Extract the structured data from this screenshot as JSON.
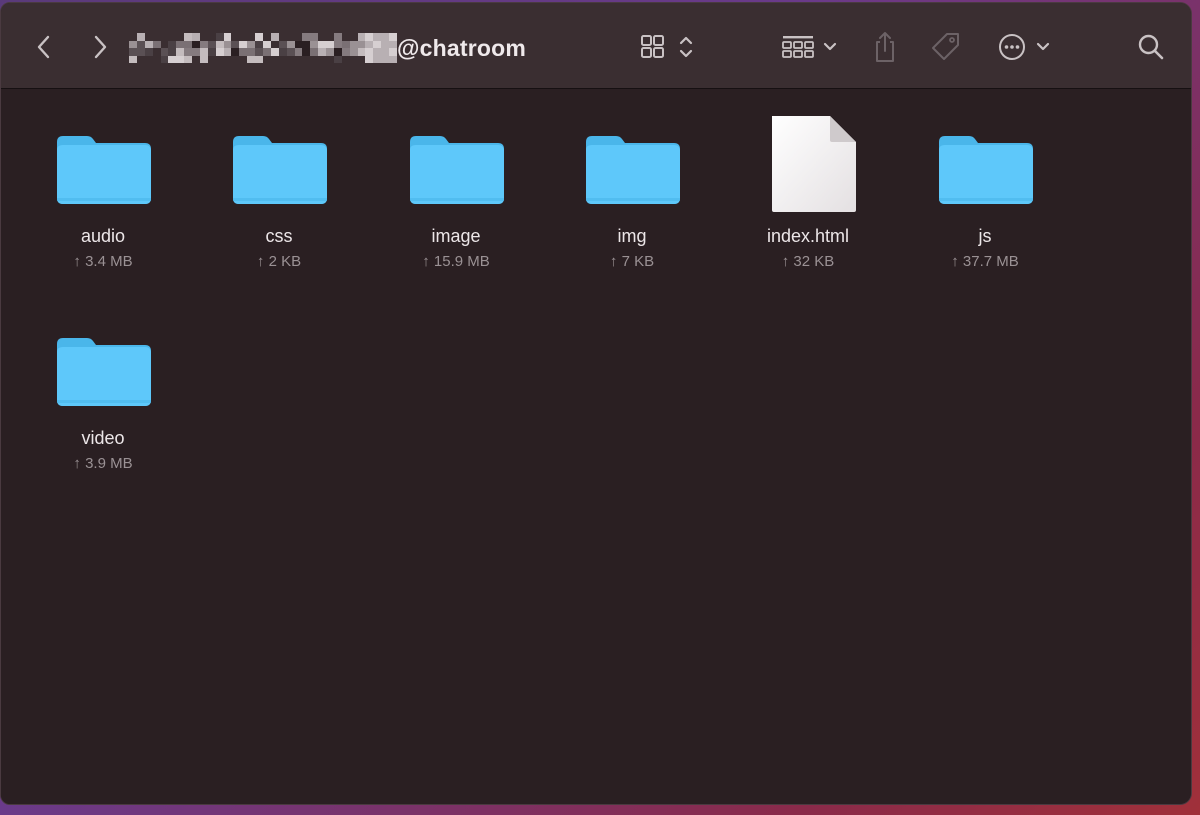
{
  "window": {
    "title": "@chatroom",
    "title_prefix_redacted": true
  },
  "toolbar": {
    "back_icon": "chevron-left-icon",
    "forward_icon": "chevron-right-icon",
    "view_icon": "grid-view-icon",
    "group_icon": "group-by-icon",
    "share_icon": "share-icon",
    "tag_icon": "tag-icon",
    "more_icon": "ellipsis-circle-icon",
    "search_icon": "search-icon"
  },
  "colors": {
    "folder": "#5ec8fa",
    "folder_tab": "#4ab6ea",
    "window_bg": "#2a1f22",
    "toolbar_bg": "#3a2e31"
  },
  "files": [
    {
      "name": "audio",
      "size": "↑ 3.4 MB",
      "kind": "folder"
    },
    {
      "name": "css",
      "size": "↑ 2 KB",
      "kind": "folder"
    },
    {
      "name": "image",
      "size": "↑ 15.9 MB",
      "kind": "folder"
    },
    {
      "name": "img",
      "size": "↑ 7 KB",
      "kind": "folder"
    },
    {
      "name": "index.html",
      "size": "↑ 32 KB",
      "kind": "document"
    },
    {
      "name": "js",
      "size": "↑ 37.7 MB",
      "kind": "folder"
    },
    {
      "name": "video",
      "size": "↑ 3.9 MB",
      "kind": "folder"
    }
  ]
}
